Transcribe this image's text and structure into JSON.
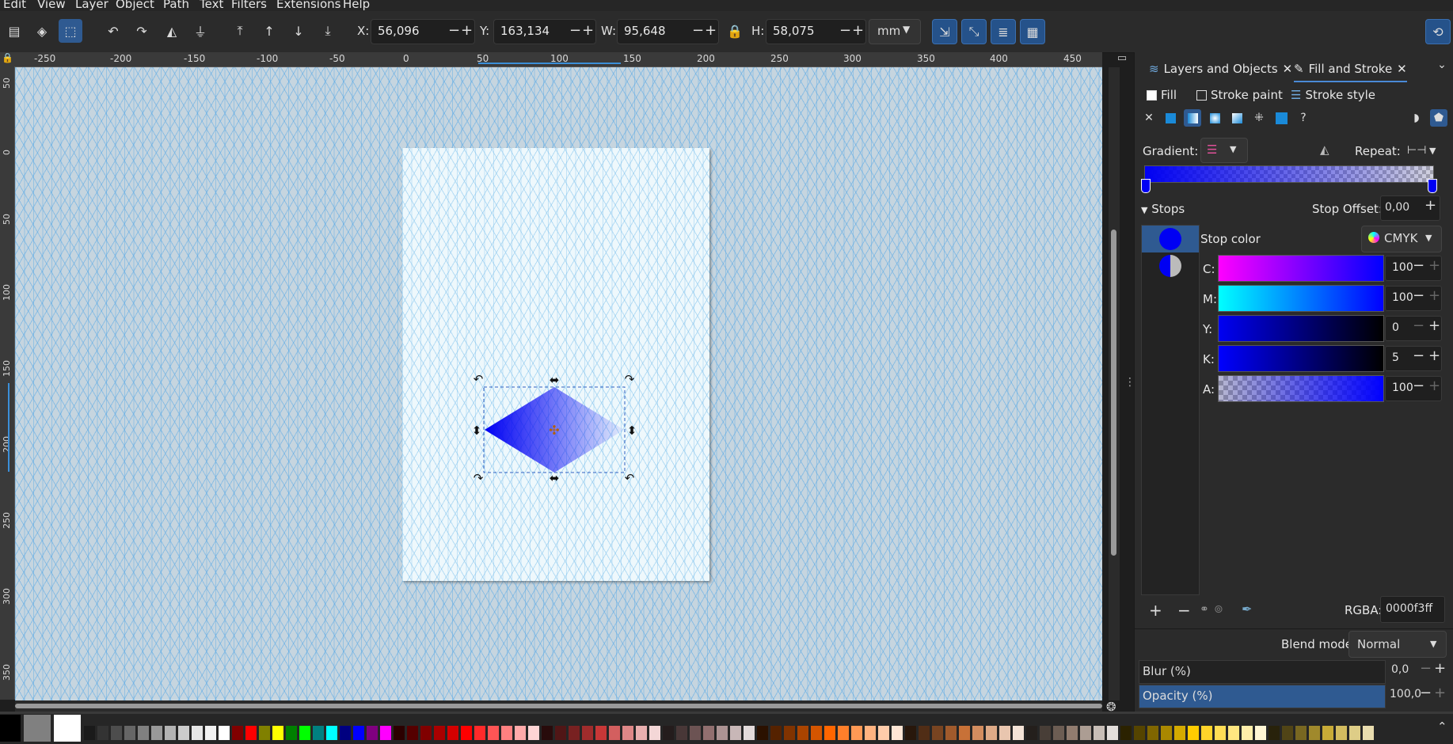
{
  "menu": [
    "Edit",
    "View",
    "Layer",
    "Object",
    "Path",
    "Text",
    "Filters",
    "Extensions",
    "Help"
  ],
  "toolbar": {
    "x_label": "X:",
    "x_value": "56,096",
    "y_label": "Y:",
    "y_value": "163,134",
    "w_label": "W:",
    "w_value": "95,648",
    "h_label": "H:",
    "h_value": "58,075",
    "unit": "mm"
  },
  "hruler": [
    "-250",
    "-200",
    "-150",
    "-100",
    "-50",
    "0",
    "50",
    "100",
    "150",
    "200",
    "250",
    "300",
    "350",
    "400",
    "450"
  ],
  "vruler": [
    "50",
    "0",
    "50",
    "100",
    "150",
    "200",
    "250",
    "300",
    "350"
  ],
  "panel": {
    "tabs": [
      {
        "label": "Layers and Objects"
      },
      {
        "label": "Fill and Stroke"
      }
    ],
    "subtabs": [
      "Fill",
      "Stroke paint",
      "Stroke style"
    ],
    "gradient_label": "Gradient:",
    "repeat_label": "Repeat:",
    "stops_label": "Stops",
    "stop_offset_label": "Stop Offset:",
    "stop_offset_value": "0,00",
    "stop_color_label": "Stop color",
    "color_mode": "CMYK",
    "channels": [
      {
        "label": "C:",
        "value": "100",
        "gradient": "linear-gradient(90deg,#ff00ff,#0000ff)"
      },
      {
        "label": "M:",
        "value": "100",
        "gradient": "linear-gradient(90deg,#00ffff,#0000ff)"
      },
      {
        "label": "Y:",
        "value": "0",
        "gradient": "linear-gradient(90deg,#0000f3,#000000)"
      },
      {
        "label": "K:",
        "value": "5",
        "gradient": "linear-gradient(90deg,#0000ff,#000000)"
      },
      {
        "label": "A:",
        "value": "100",
        "gradient": "linear-gradient(90deg,rgba(0,0,255,0),#0000ff)"
      }
    ],
    "rgba_label": "RGBA:",
    "rgba_value": "0000f3ff",
    "blend_label": "Blend mode:",
    "blend_value": "Normal",
    "blur_label": "Blur (%)",
    "blur_value": "0,0",
    "opacity_label": "Opacity (%)",
    "opacity_value": "100,0"
  },
  "colors": {
    "accent": "#2f5a91",
    "stop_color": "#0000f3"
  },
  "palette_colors": [
    "#000000",
    "#808080",
    "#ffffff",
    "#1a1a1a",
    "#333333",
    "#4d4d4d",
    "#666666",
    "#808080",
    "#999999",
    "#b3b3b3",
    "#cccccc",
    "#e6e6e6",
    "#f2f2f2",
    "#ffffff",
    "#800000",
    "#ff0000",
    "#808000",
    "#ffff00",
    "#008000",
    "#00ff00",
    "#008080",
    "#00ffff",
    "#000080",
    "#0000ff",
    "#800080",
    "#ff00ff",
    "#2b0000",
    "#550000",
    "#800000",
    "#aa0000",
    "#d40000",
    "#ff0000",
    "#ff2a2a",
    "#ff5555",
    "#ff8080",
    "#ffaaaa",
    "#ffd5d5",
    "#280b0b",
    "#501616",
    "#782121",
    "#a02c2c",
    "#c83737",
    "#d35f5f",
    "#de8787",
    "#e9afaf",
    "#f4d7d7",
    "#241c1c",
    "#483737",
    "#6c5353",
    "#916f6f",
    "#ac9393",
    "#c8b7b7",
    "#e3dbdb",
    "#2b1100",
    "#552200",
    "#803300",
    "#aa4400",
    "#d45500",
    "#ff6600",
    "#ff7f2a",
    "#ff9955",
    "#ffb380",
    "#ffccaa",
    "#ffe6d5",
    "#28170b",
    "#502d16",
    "#784421",
    "#a05a2c",
    "#c87137",
    "#d38d5f",
    "#deaa87",
    "#e9c6af",
    "#f4e3d7",
    "#241f1c",
    "#483e37",
    "#6c5d53",
    "#917c6f",
    "#ac9d93",
    "#c8beb7",
    "#e3dedb",
    "#2b2200",
    "#554400",
    "#806600",
    "#aa8800",
    "#d4aa00",
    "#ffcc00",
    "#ffd42a",
    "#ffdd55",
    "#ffe680",
    "#ffeeaa",
    "#fff6d5",
    "#28220b",
    "#504416",
    "#786721",
    "#a0892c",
    "#c8ab37",
    "#d3bc5f",
    "#decd87",
    "#e9ddaf"
  ]
}
